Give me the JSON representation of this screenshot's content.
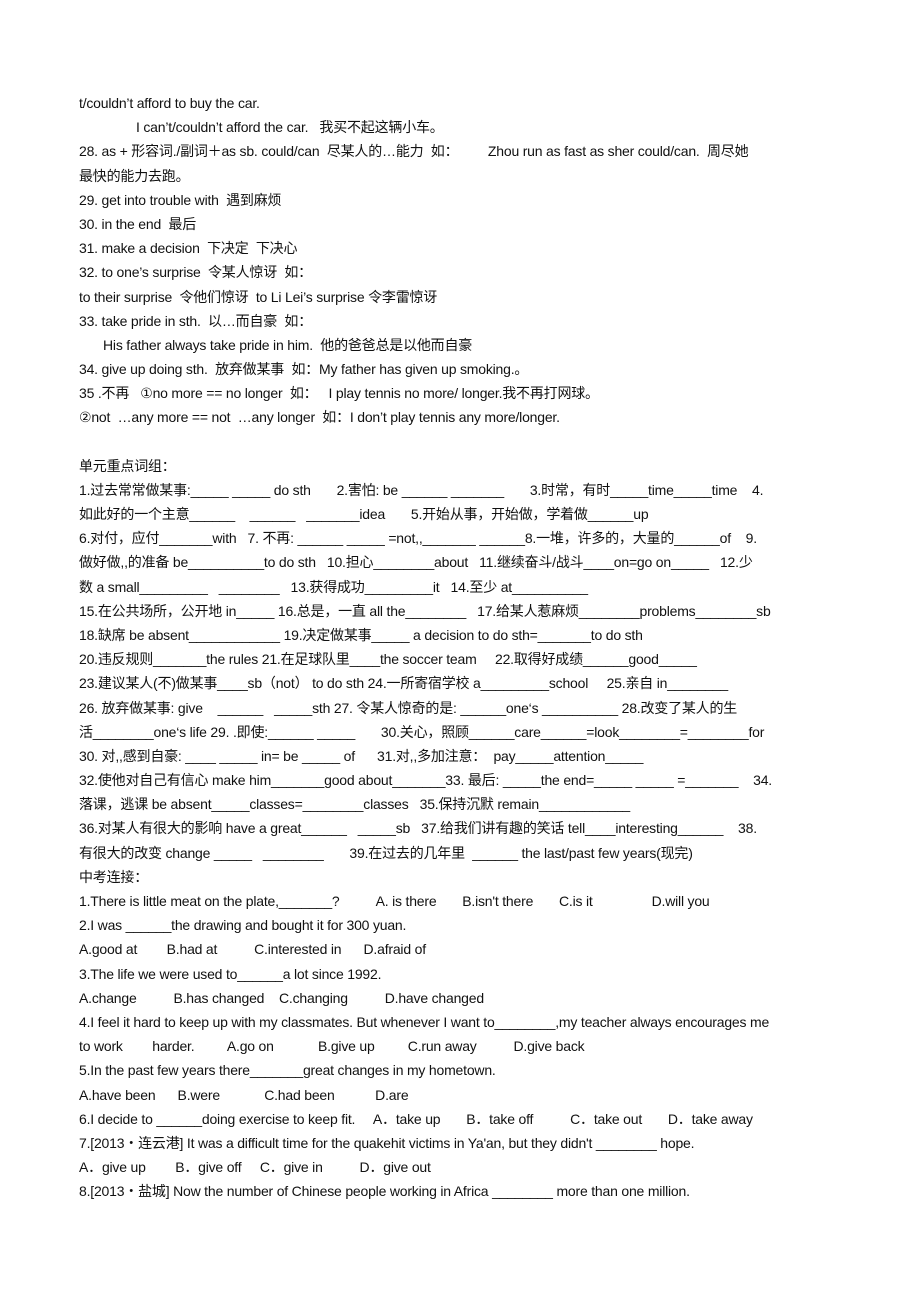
{
  "phrases": [
    "t/couldn’t afford to buy the car.",
    "I can’t/couldn’t afford the car.   我买不起这辆小车。",
    "28. as + 形容词./副词＋as sb. could/can  尽某人的…能力  如：        Zhou run as fast as sher could/can.  周尽她",
    "最快的能力去跑。",
    "29. get into trouble with  遇到麻烦",
    "30. in the end  最后",
    "31. make a decision  下决定  下决心",
    "32. to one’s surprise  令某人惊讶  如：",
    "to their surprise  令他们惊讶  to Li Lei’s surprise 令李雷惊讶",
    "33. take pride in sth.  以…而自豪  如：",
    "His father always take pride in him.  他的爸爸总是以他而自豪",
    "34. give up doing sth.  放弃做某事  如：My father has given up smoking.。",
    "35 .不再   ①no more == no longer  如：   I play tennis no more/ longer.我不再打网球。",
    "②not  …any more == not  …any longer  如：I don’t play tennis any more/longer."
  ],
  "unit_section": {
    "heading": "单元重点词组：",
    "lines": [
      "1.过去常常做某事:_____ _____ do sth       2.害怕: be ______ _______       3.时常，有时_____time_____time    4.",
      "如此好的一个主意______    ______   _______idea       5.开始从事，开始做，学着做______up",
      "6.对付，应付_______with   7. 不再: ______ _____ =not,,_______ ______8.一堆，许多的，大量的______of    9.",
      "做好做,,的准备 be__________to do sth   10.担心________about   11.继续奋斗/战斗____on=go on_____   12.少",
      "数 a small_________   ________   13.获得成功_________it   14.至少 at__________",
      "15.在公共场所，公开地 in_____ 16.总是，一直 all the________   17.给某人惹麻烦________problems________sb",
      "18.缺席 be absent____________ 19.决定做某事_____ a decision to do sth=_______to do sth",
      "20.违反规则_______the rules 21.在足球队里____the soccer team     22.取得好成绩______good_____",
      "23.建议某人(不)做某事____sb（not） to do sth 24.一所寄宿学校 a_________school     25.亲自 in________",
      "26. 放弃做某事: give    ______   _____sth 27. 令某人惊奇的是: ______one‘s __________ 28.改变了某人的生",
      "活________one‘s life 29. .即使:______ _____       30.关心，照顾______care______=look________=________for",
      "30. 对,,感到自豪: ____ _____ in= be _____ of      31.对,,多加注意：  pay_____attention_____",
      "32.使他对自己有信心 make him_______good about_______33. 最后: _____the end=_____ _____ =_______    34.",
      "落课，逃课 be absent_____classes=________classes   35.保持沉默 remain____________",
      "36.对某人有很大的影响 have a great______   _____sb   37.给我们讲有趣的笑话 tell____interesting______    38.",
      "有很大的改变 change _____   ________       39.在过去的几年里  ______ the last/past few years(现完)"
    ]
  },
  "exam_section": {
    "heading": "中考连接：",
    "lines": [
      "1.There is little meat on the plate,_______?          A. is there       B.isn't there       C.is it                D.will you",
      "2.I was ______the drawing and bought it for 300 yuan.",
      "A.good at        B.had at          C.interested in      D.afraid of",
      "3.The life we were used to______a lot since 1992.",
      "A.change          B.has changed    C.changing          D.have changed",
      "4.I feel it hard to keep up with my classmates. But whenever I want to________,my teacher always encourages me",
      "to work        harder.         A.go on            B.give up         C.run away          D.give back",
      "5.In the past few years there_______great changes in my hometown.",
      "A.have been      B.were            C.had been           D.are",
      "6.I decide to ______doing exercise to keep fit.     A．take up       B．take off          C．take out       D．take away",
      "7.[2013・连云港] It was a difficult time for the quakehit victims in Ya'an, but they didn't ________ hope.",
      "A．give up        B．give off     C．give in          D．give out",
      "8.[2013・盐城] Now the number of Chinese people working in Africa ________ more than one million."
    ]
  }
}
